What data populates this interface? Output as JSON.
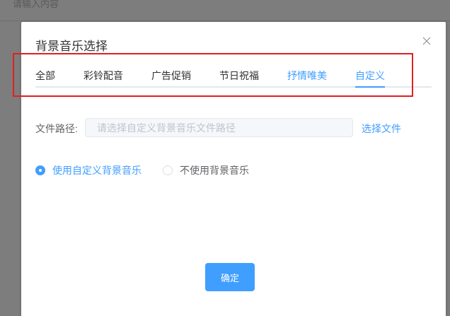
{
  "background": {
    "input_placeholder": "请输入内容"
  },
  "dialog": {
    "title": "背景音乐选择",
    "tabs": [
      {
        "label": "全部",
        "active": false
      },
      {
        "label": "彩铃配音",
        "active": false
      },
      {
        "label": "广告促销",
        "active": false
      },
      {
        "label": "节日祝福",
        "active": false
      },
      {
        "label": "抒情唯美",
        "active": false
      },
      {
        "label": "自定义",
        "active": true
      }
    ],
    "file_path": {
      "label": "文件路径:",
      "placeholder": "请选择自定义背景音乐文件路径",
      "value": "",
      "choose_label": "选择文件"
    },
    "radios": [
      {
        "label": "使用自定义背景音乐",
        "checked": true
      },
      {
        "label": "不使用背景音乐",
        "checked": false
      }
    ],
    "confirm_label": "确定"
  },
  "colors": {
    "accent": "#409eff",
    "annotation": "#e02020",
    "overlay": "#7d7d7d"
  },
  "icons": {
    "close": "close-icon",
    "radio": "radio-icon"
  }
}
